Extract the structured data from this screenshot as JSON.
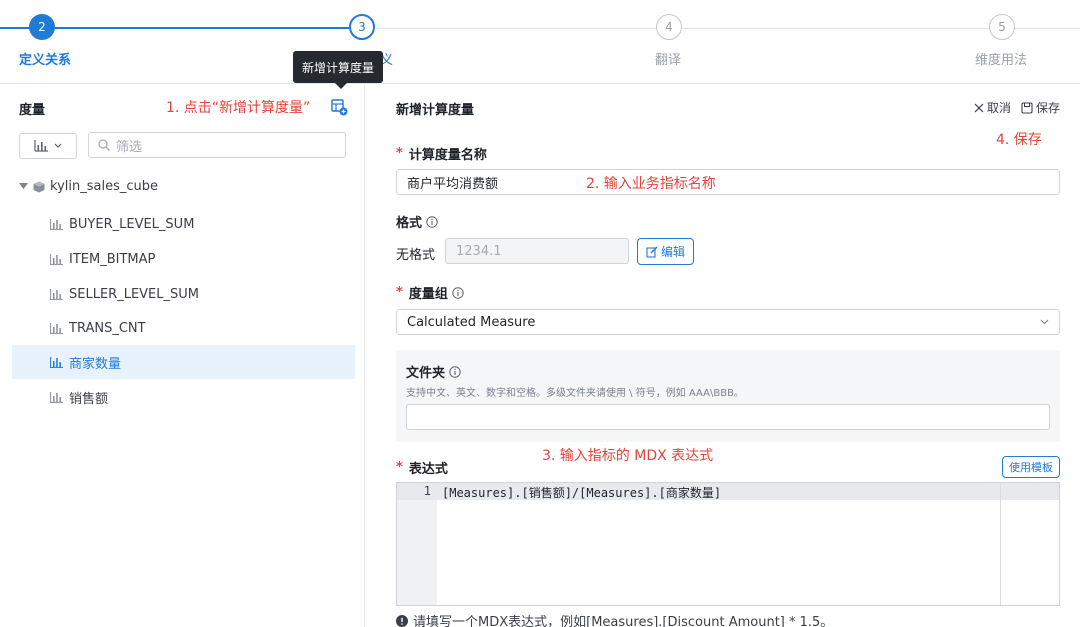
{
  "stepper": {
    "steps": [
      {
        "number": "2",
        "label": "定义关系"
      },
      {
        "number": "3",
        "label": "义"
      },
      {
        "number": "4",
        "label": "翻译"
      },
      {
        "number": "5",
        "label": "维度用法"
      }
    ],
    "tooltip": "新增计算度量"
  },
  "left": {
    "title": "度量",
    "annotation": "1. 点击“新增计算度量”",
    "filter_placeholder": "筛选",
    "cube_name": "kylin_sales_cube",
    "measures": [
      "BUYER_LEVEL_SUM",
      "ITEM_BITMAP",
      "SELLER_LEVEL_SUM",
      "TRANS_CNT",
      "商家数量",
      "销售额"
    ]
  },
  "right": {
    "title": "新增计算度量",
    "cancel_label": "取消",
    "save_label": "保存",
    "save_annotation": "4. 保存",
    "name_label": "计算度量名称",
    "name_value": "商户平均消费额",
    "name_annotation": "2. 输入业务指标名称",
    "format_label": "格式",
    "format_type": "无格式",
    "format_value": "1234.1",
    "edit_label": "编辑",
    "group_label": "度量组",
    "group_value": "Calculated Measure",
    "folder_label": "文件夹",
    "folder_hint": "支持中文、英文、数字和空格。多级文件夹请使用 \\ 符号，例如 AAA\\BBB。",
    "expression_label": "表达式",
    "expression_annotation": "3. 输入指标的 MDX 表达式",
    "template_label": "使用模板",
    "line_number": "1",
    "code": "[Measures].[销售额]/[Measures].[商家数量]",
    "bottom_hint": "请填写一个MDX表达式，例如[Measures].[Discount Amount] * 1.5。"
  },
  "colors": {
    "accent": "#1f7ad8",
    "annotation": "#e8423a",
    "selected_bg": "#e8f2fc"
  }
}
